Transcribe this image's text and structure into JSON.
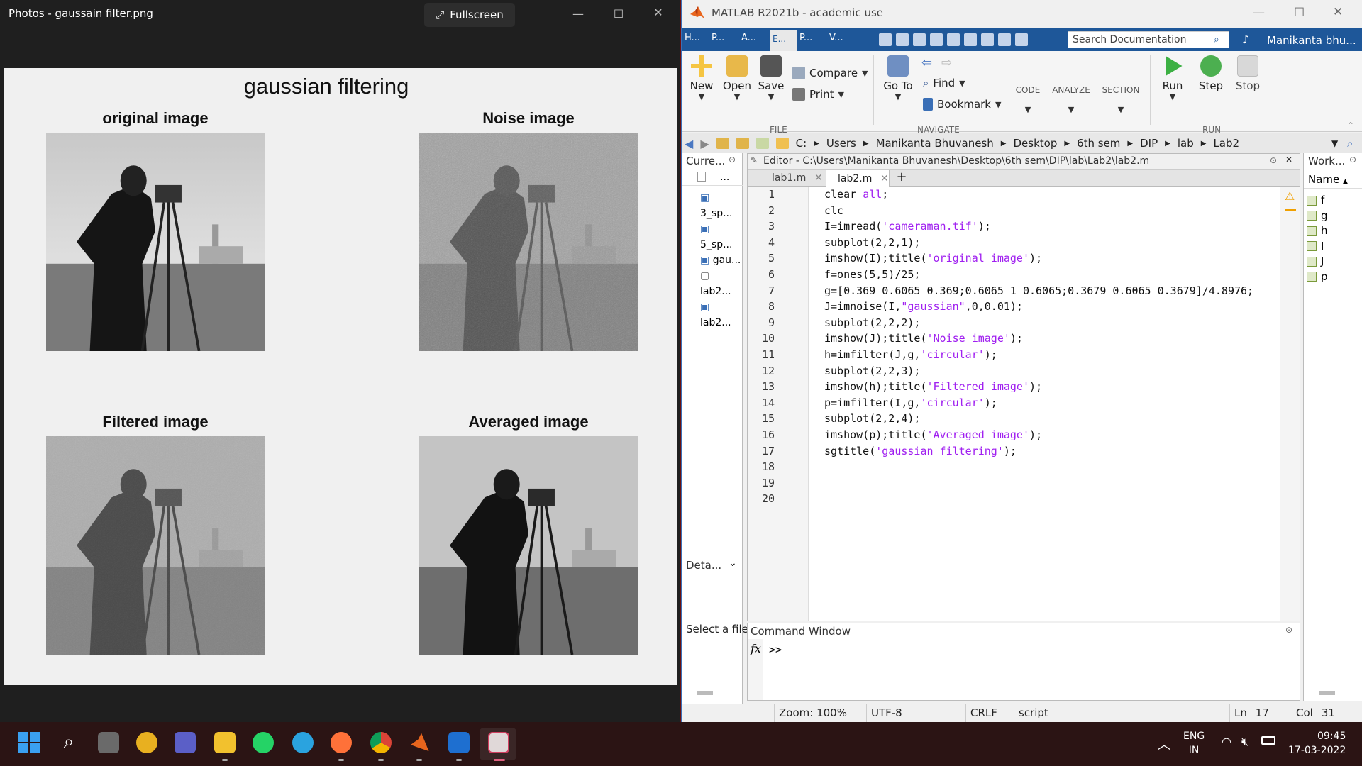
{
  "photos": {
    "window_title": "Photos - gaussain filter.png",
    "fullscreen_label": "Fullscreen",
    "figure": {
      "title": "gaussian filtering",
      "subplots": [
        {
          "title": "original image"
        },
        {
          "title": "Noise image"
        },
        {
          "title": "Filtered image"
        },
        {
          "title": "Averaged image"
        }
      ]
    }
  },
  "matlab": {
    "window_title": "MATLAB R2021b - academic use",
    "top_tabs": [
      "H...",
      "P...",
      "A...",
      "E...",
      "P...",
      "V..."
    ],
    "search_placeholder": "Search Documentation",
    "user": "Manikanta bhu...",
    "ribbon": {
      "new": "New",
      "open": "Open",
      "save": "Save",
      "compare": "Compare",
      "print": "Print",
      "goto": "Go To",
      "find": "Find",
      "bookmark": "Bookmark",
      "code": "CODE",
      "analyze": "ANALYZE",
      "section": "SECTION",
      "run": "Run",
      "step": "Step",
      "stop": "Stop",
      "sections": {
        "file": "FILE",
        "navigate": "NAVIGATE",
        "run": "RUN"
      }
    },
    "path": [
      "C:",
      "Users",
      "Manikanta Bhuvanesh",
      "Desktop",
      "6th sem",
      "DIP",
      "lab",
      "Lab2"
    ],
    "current_folder": {
      "title": "Curre...",
      "col": "...",
      "files": [
        "3_sp...",
        "5_sp...",
        "gau...",
        "lab2...",
        "lab2..."
      ]
    },
    "details": {
      "title": "Deta...",
      "hint": "Select a file"
    },
    "editor": {
      "title": "Editor - C:\\Users\\Manikanta Bhuvanesh\\Desktop\\6th sem\\DIP\\lab\\Lab2\\lab2.m",
      "tabs": [
        "lab1.m",
        "lab2.m"
      ],
      "active_tab": "lab2.m",
      "line_numbers": [
        "1",
        "2",
        "3",
        "4",
        "5",
        "6",
        "7",
        "8",
        "9",
        "10",
        "11",
        "12",
        "13",
        "14",
        "15",
        "16",
        "17",
        "18",
        "19",
        "20"
      ],
      "lines": [
        [
          "clear ",
          "all",
          ";"
        ],
        [
          "clc",
          "",
          ""
        ],
        [
          "I=imread(",
          "'cameraman.tif'",
          ");"
        ],
        [
          "subplot(2,2,1);",
          "",
          ""
        ],
        [
          "imshow(I);title(",
          "'original image'",
          ");"
        ],
        [
          "f=ones(5,5)/25;",
          "",
          ""
        ],
        [
          "g=[0.369 0.6065 0.369;0.6065 1 0.6065;0.3679 0.6065 0.3679]/4.8976;",
          "",
          ""
        ],
        [
          "J=imnoise(I,",
          "\"gaussian\"",
          ",0,0.01);"
        ],
        [
          "subplot(2,2,2);",
          "",
          ""
        ],
        [
          "imshow(J);title(",
          "'Noise image'",
          ");"
        ],
        [
          "h=imfilter(J,g,",
          "'circular'",
          ");"
        ],
        [
          "subplot(2,2,3);",
          "",
          ""
        ],
        [
          "imshow(h);title(",
          "'Filtered image'",
          ");"
        ],
        [
          "p=imfilter(I,g,",
          "'circular'",
          ");"
        ],
        [
          "subplot(2,2,4);",
          "",
          ""
        ],
        [
          "imshow(p);title(",
          "'Averaged image'",
          ");"
        ],
        [
          "sgtitle(",
          "'gaussian filtering'",
          ");"
        ],
        [
          "",
          "",
          ""
        ],
        [
          "",
          "",
          ""
        ],
        [
          "",
          "",
          ""
        ]
      ]
    },
    "command_window": {
      "title": "Command Window",
      "fx": "fx",
      "prompt": ">>"
    },
    "workspace": {
      "title": "Work...",
      "col": "Name",
      "vars": [
        "f",
        "g",
        "h",
        "I",
        "J",
        "p"
      ]
    },
    "status": {
      "zoom": "Zoom: 100%",
      "encoding": "UTF-8",
      "eol": "CRLF",
      "type": "script",
      "ln_label": "Ln",
      "ln": "17",
      "col_label": "Col",
      "col": "31"
    }
  },
  "tray": {
    "lang": "ENG",
    "region": "IN",
    "time": "09:45",
    "date": "17-03-2022"
  }
}
